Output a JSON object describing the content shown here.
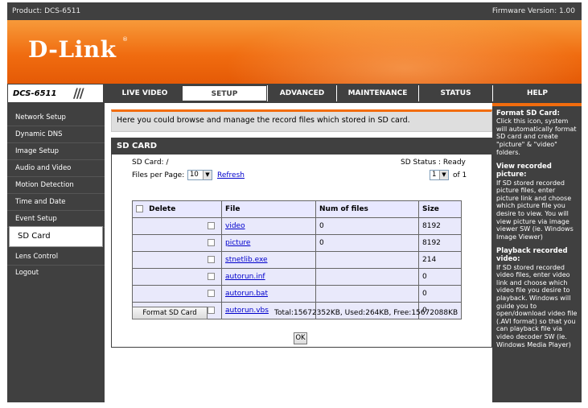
{
  "top": {
    "product": "Product: DCS-6511",
    "firmware": "Firmware Version: 1.00"
  },
  "brand": {
    "logo": "D-Link",
    "registered": "®"
  },
  "nav": {
    "model": "DCS-6511",
    "tabs": [
      "LIVE VIDEO",
      "SETUP",
      "ADVANCED",
      "MAINTENANCE",
      "STATUS",
      "HELP"
    ],
    "active": "SETUP"
  },
  "sidebar": {
    "items": [
      "Network Setup",
      "Dynamic DNS",
      "Image Setup",
      "Audio and Video",
      "Motion Detection",
      "Time and Date",
      "Event Setup",
      "SD Card",
      "Lens Control",
      "Logout"
    ],
    "active": "SD Card"
  },
  "main": {
    "intro": "Here you could browse and manage the record files which stored in SD card.",
    "panel_title": "SD CARD",
    "sd_card_path": "SD Card: /",
    "sd_status": "SD Status : Ready",
    "files_per_page_label": "Files per Page:",
    "files_per_page_value": "10",
    "refresh": "Refresh",
    "page_value": "1",
    "page_of": "of 1",
    "table": {
      "headers": [
        "Delete",
        "File",
        "Num of files",
        "Size"
      ],
      "rows": [
        {
          "file": "video",
          "num": "0",
          "size": "8192"
        },
        {
          "file": "picture",
          "num": "0",
          "size": "8192"
        },
        {
          "file": "stnetlib.exe",
          "num": "",
          "size": "214"
        },
        {
          "file": "autorun.inf",
          "num": "",
          "size": "0"
        },
        {
          "file": "autorun.bat",
          "num": "",
          "size": "0"
        },
        {
          "file": "autorun.vbs",
          "num": "",
          "size": "0"
        }
      ]
    },
    "format_button": "Format SD Card",
    "totals": "Total:15672352KB, Used:264KB, Free:15672088KB",
    "ok_button": "OK"
  },
  "help": {
    "sections": [
      {
        "title": "Format SD Card:",
        "body": "Click this icon, system will automatically format SD card and create \"picture\" & \"video\" folders."
      },
      {
        "title": "View recorded picture:",
        "body": "If SD stored recorded picture files, enter picture link and choose which picture file you desire to view. You will view picture via image viewer SW (ie. Windows Image Viewer)"
      },
      {
        "title": "Playback recorded video:",
        "body": "If SD stored recorded video files, enter video link and choose which video file you desire to playback. Windows will guide you to open/download video file (.AVI format) so that you can playback file via video decoder SW (ie. Windows Media Player)"
      }
    ]
  },
  "colors": {
    "accent": "#f26c0d",
    "dark": "#404040",
    "link": "#0000cc"
  }
}
